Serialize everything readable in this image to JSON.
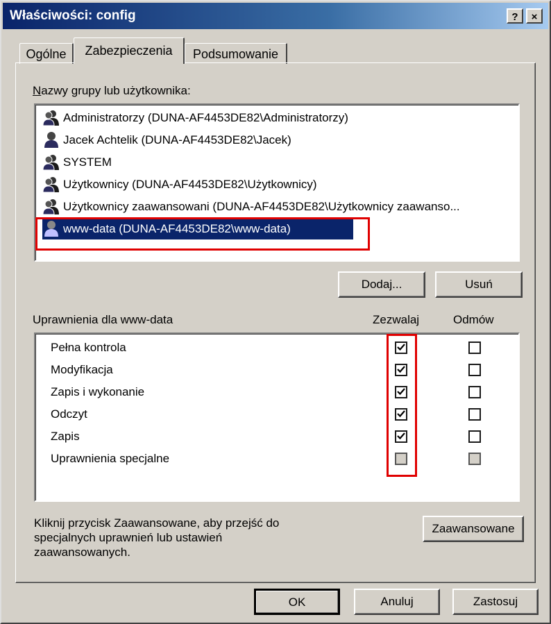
{
  "window": {
    "title": "Właściwości: config",
    "help_label": "?",
    "close_label": "×"
  },
  "tabs": [
    {
      "label": "Ogólne",
      "active": false
    },
    {
      "label": "Zabezpieczenia",
      "active": true
    },
    {
      "label": "Podsumowanie",
      "active": false
    }
  ],
  "groups": {
    "label": "Nazwy grupy lub użytkownika:",
    "items": [
      {
        "name": "Administratorzy (DUNA-AF4453DE82\\Administratorzy)",
        "icon": "group-icon"
      },
      {
        "name": "Jacek Achtelik (DUNA-AF4453DE82\\Jacek)",
        "icon": "user-icon"
      },
      {
        "name": "SYSTEM",
        "icon": "group-icon"
      },
      {
        "name": "Użytkownicy (DUNA-AF4453DE82\\Użytkownicy)",
        "icon": "group-icon"
      },
      {
        "name": "Użytkownicy zaawansowani (DUNA-AF4453DE82\\Użytkownicy zaawanso...",
        "icon": "group-icon"
      },
      {
        "name": "www-data (DUNA-AF4453DE82\\www-data)",
        "icon": "user-icon",
        "selected": true
      }
    ],
    "add_button": "Dodaj...",
    "remove_button": "Usuń"
  },
  "permissions": {
    "label": "Uprawnienia dla www-data",
    "col_allow": "Zezwalaj",
    "col_deny": "Odmów",
    "rows": [
      {
        "name": "Pełna kontrola",
        "allow": "checked",
        "deny": "unchecked"
      },
      {
        "name": "Modyfikacja",
        "allow": "checked",
        "deny": "unchecked"
      },
      {
        "name": "Zapis i wykonanie",
        "allow": "checked",
        "deny": "unchecked"
      },
      {
        "name": "Odczyt",
        "allow": "checked",
        "deny": "unchecked"
      },
      {
        "name": "Zapis",
        "allow": "checked",
        "deny": "unchecked"
      },
      {
        "name": "Uprawnienia specjalne",
        "allow": "disabled",
        "deny": "disabled"
      }
    ]
  },
  "advanced": {
    "text_line1": "Kliknij przycisk Zaawansowane, aby przejść do",
    "text_line2": "specjalnych uprawnień lub ustawień",
    "text_line3": "zaawansowanych.",
    "button": "Zaawansowane"
  },
  "footer": {
    "ok": "OK",
    "cancel": "Anuluj",
    "apply": "Zastosuj"
  },
  "colors": {
    "selection": "#0a246a",
    "highlight": "#e00000",
    "face": "#d4d0c8"
  }
}
